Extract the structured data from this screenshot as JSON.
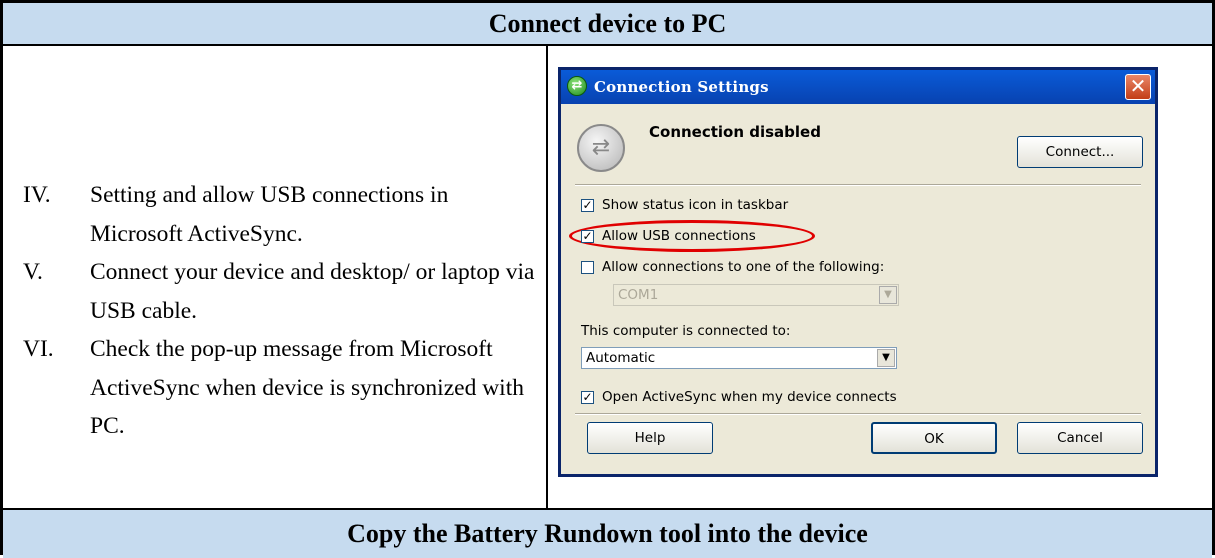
{
  "header": {
    "title": "Connect device to PC"
  },
  "steps": [
    {
      "num": "IV.",
      "text": "Setting and allow USB connections in Microsoft ActiveSync."
    },
    {
      "num": "V.",
      "text": "Connect your device and desktop/ or laptop via USB cable."
    },
    {
      "num": "VI.",
      "text": "Check the pop-up message from Microsoft ActiveSync when device is synchronized with PC."
    }
  ],
  "dialog": {
    "title": "Connection Settings",
    "status": "Connection disabled",
    "connect_label": "Connect...",
    "show_status_icon": {
      "label": "Show status icon in taskbar",
      "checked": true
    },
    "allow_usb": {
      "label": "Allow USB connections",
      "checked": true,
      "highlighted": true
    },
    "allow_conn_to": {
      "label": "Allow connections to one of the following:",
      "checked": false
    },
    "port_select": {
      "value": "COM1",
      "enabled": false
    },
    "connected_to_label": "This computer is connected to:",
    "connected_to_select": {
      "value": "Automatic"
    },
    "open_activesync": {
      "label": "Open ActiveSync when my device connects",
      "checked": true
    },
    "help_label": "Help",
    "ok_label": "OK",
    "cancel_label": "Cancel",
    "close_symbol": "✕"
  },
  "footer": {
    "title": "Copy the Battery Rundown tool into the device"
  },
  "colors": {
    "header_bg": "#c6dbef",
    "highlight_ring": "#e00000",
    "titlebar": "#0a5bd8"
  }
}
